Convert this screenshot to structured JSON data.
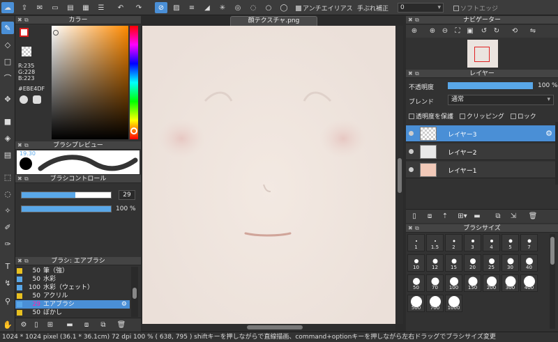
{
  "toolbar": {
    "antialias_label": "アンチエイリアス",
    "stabilizer_label": "手ぶれ補正",
    "stabilizer_value": "0",
    "soft_edge_label": "ソフトエッジ"
  },
  "document": {
    "tab_title": "顔テクスチャ.png"
  },
  "color_panel": {
    "title": "カラー",
    "r": "R:235",
    "g": "G:228",
    "b": "B:223",
    "hex": "#EBE4DF",
    "current_color": "#ebe4df",
    "fg_color": "#d81e1e"
  },
  "brush_preview": {
    "title": "ブラシプレビュー",
    "size_label": "19.30"
  },
  "brush_control": {
    "title": "ブラシコントロール",
    "size_value": "29",
    "size_fraction": 0.6,
    "opacity_value": "100 %",
    "opacity_fraction": 1.0
  },
  "brush_list": {
    "title": "ブラシ: エアブラシ",
    "items": [
      {
        "size": "50",
        "name": "筆（強）",
        "color": "#e8c020"
      },
      {
        "size": "50",
        "name": "水彩",
        "color": "#59a7e8"
      },
      {
        "size": "100",
        "name": "水彩（ウェット）",
        "color": "#59a7e8"
      },
      {
        "size": "50",
        "name": "アクリル",
        "color": "#e8c020"
      },
      {
        "size": "29",
        "name": "エアブラシ",
        "color": "#59a7e8"
      },
      {
        "size": "50",
        "name": "ぼかし",
        "color": "#e8c020"
      }
    ]
  },
  "navigator": {
    "title": "ナビゲーター"
  },
  "layers": {
    "title": "レイヤー",
    "opacity_label": "不透明度",
    "opacity_value": "100 %",
    "opacity_fraction": 1.0,
    "blend_label": "ブレンド",
    "blend_value": "通常",
    "protect_alpha": "透明度を保護",
    "clipping": "クリッピング",
    "lock": "ロック",
    "items": [
      {
        "name": "レイヤー3",
        "selected": true
      },
      {
        "name": "レイヤー2",
        "selected": false
      },
      {
        "name": "レイヤー1",
        "selected": false
      }
    ]
  },
  "brush_size": {
    "title": "ブラシサイズ",
    "sizes": [
      "1",
      "1.5",
      "2",
      "3",
      "4",
      "5",
      "7",
      "10",
      "12",
      "15",
      "20",
      "25",
      "30",
      "40",
      "50",
      "70",
      "100",
      "150",
      "200",
      "300",
      "400",
      "500",
      "700",
      "1000"
    ]
  },
  "status": {
    "text": "1024 * 1024 pixel   (36.1 * 36.1cm)   72 dpi   100 %   ( 638, 795 )   shiftキーを押しながらで直線描画、command+optionキーを押しながら左右ドラッグでブラシサイズ変更"
  }
}
